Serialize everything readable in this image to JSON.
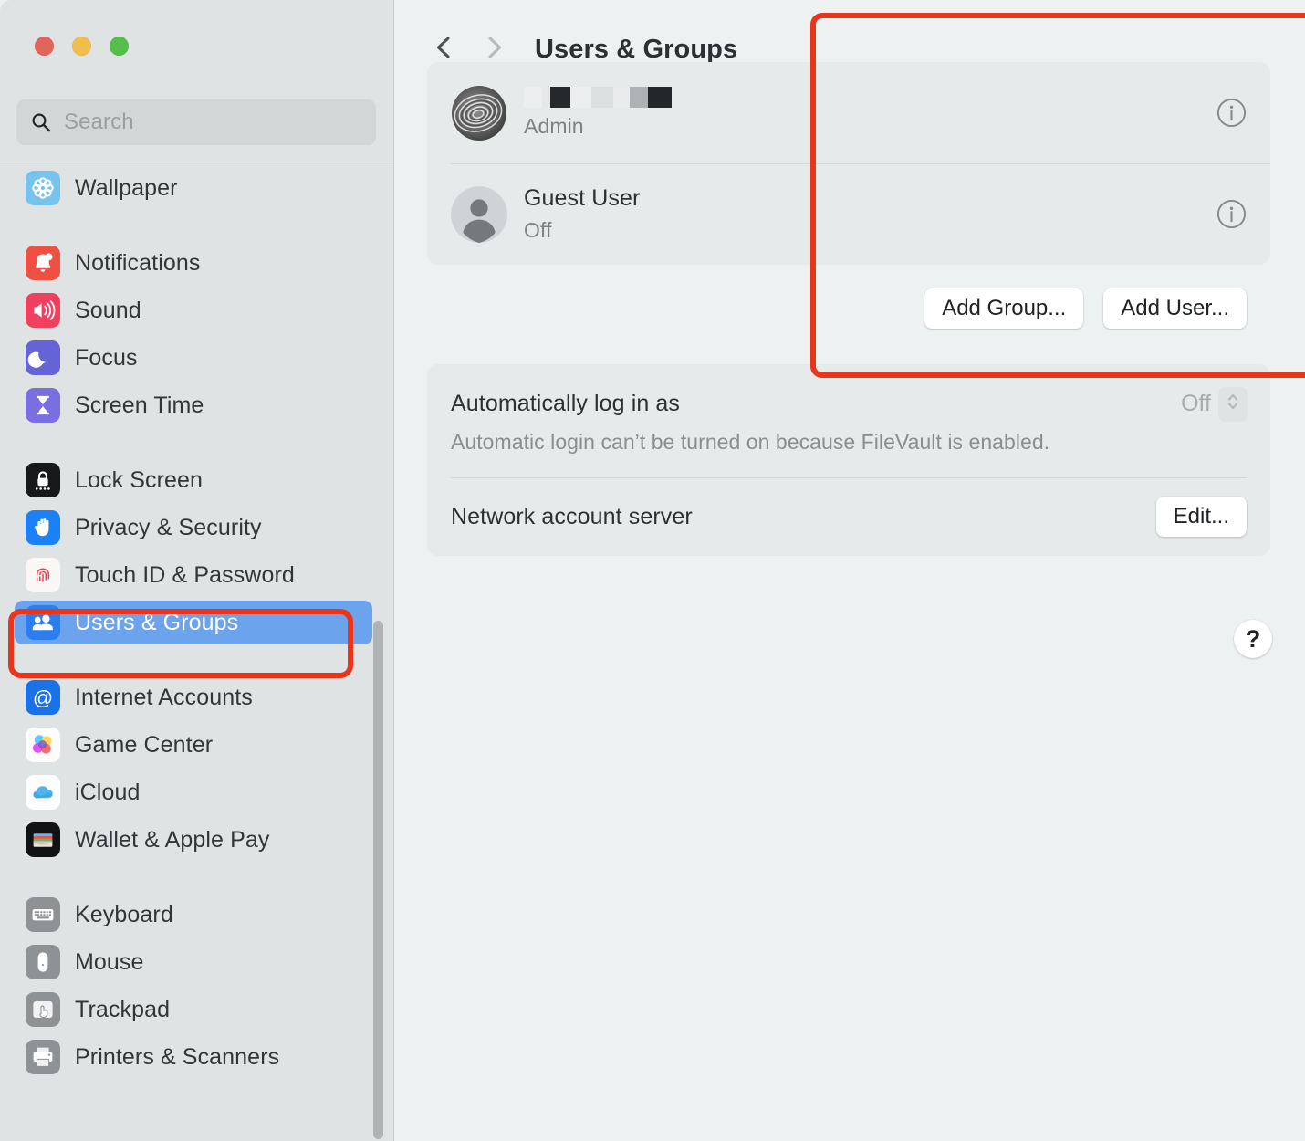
{
  "window": {
    "traffic_lights": [
      {
        "name": "close",
        "color": "#e0665c"
      },
      {
        "name": "minimize",
        "color": "#f0be4d"
      },
      {
        "name": "zoom",
        "color": "#54c04a"
      }
    ]
  },
  "search": {
    "placeholder": "Search",
    "value": "",
    "icon": "search-icon"
  },
  "sidebar": {
    "groups": [
      {
        "items": [
          {
            "label": "Wallpaper",
            "icon": "wallpaper-icon",
            "selected": false
          }
        ]
      },
      {
        "items": [
          {
            "label": "Notifications",
            "icon": "notifications-icon",
            "selected": false
          },
          {
            "label": "Sound",
            "icon": "sound-icon",
            "selected": false
          },
          {
            "label": "Focus",
            "icon": "focus-icon",
            "selected": false
          },
          {
            "label": "Screen Time",
            "icon": "screen-time-icon",
            "selected": false
          }
        ]
      },
      {
        "items": [
          {
            "label": "Lock Screen",
            "icon": "lock-screen-icon",
            "selected": false
          },
          {
            "label": "Privacy & Security",
            "icon": "privacy-security-icon",
            "selected": false
          },
          {
            "label": "Touch ID & Password",
            "icon": "touch-id-icon",
            "selected": false
          },
          {
            "label": "Users & Groups",
            "icon": "users-groups-icon",
            "selected": true
          }
        ]
      },
      {
        "items": [
          {
            "label": "Internet Accounts",
            "icon": "internet-accounts-icon",
            "selected": false
          },
          {
            "label": "Game Center",
            "icon": "game-center-icon",
            "selected": false
          },
          {
            "label": "iCloud",
            "icon": "icloud-icon",
            "selected": false
          },
          {
            "label": "Wallet & Apple Pay",
            "icon": "wallet-icon",
            "selected": false
          }
        ]
      },
      {
        "items": [
          {
            "label": "Keyboard",
            "icon": "keyboard-icon",
            "selected": false
          },
          {
            "label": "Mouse",
            "icon": "mouse-icon",
            "selected": false
          },
          {
            "label": "Trackpad",
            "icon": "trackpad-icon",
            "selected": false
          },
          {
            "label": "Printers & Scanners",
            "icon": "printers-scanners-icon",
            "selected": false
          }
        ]
      }
    ]
  },
  "header": {
    "title": "Users & Groups",
    "back_icon": "chevron-left-icon",
    "forward_icon": "chevron-right-icon"
  },
  "users": [
    {
      "name": "",
      "name_redacted": true,
      "role": "Admin",
      "avatar": "fingerprint-avatar",
      "info_icon": "info-icon"
    },
    {
      "name": "Guest User",
      "name_redacted": false,
      "role": "Off",
      "avatar": "person-avatar",
      "info_icon": "info-icon"
    }
  ],
  "user_actions": {
    "add_group_label": "Add Group...",
    "add_user_label": "Add User..."
  },
  "options": {
    "auto_login_label": "Automatically log in as",
    "auto_login_value": "Off",
    "auto_login_hint": "Automatic login can’t be turned on because FileVault is enabled.",
    "stepper_icon": "chevron-up-down-icon",
    "network_server_label": "Network account server",
    "network_server_button": "Edit..."
  },
  "help": {
    "label": "?"
  },
  "annotations": {
    "color": "#e8351c",
    "boxes": [
      {
        "target": "users-groups-sidebar-item"
      },
      {
        "target": "users-panel"
      }
    ]
  }
}
